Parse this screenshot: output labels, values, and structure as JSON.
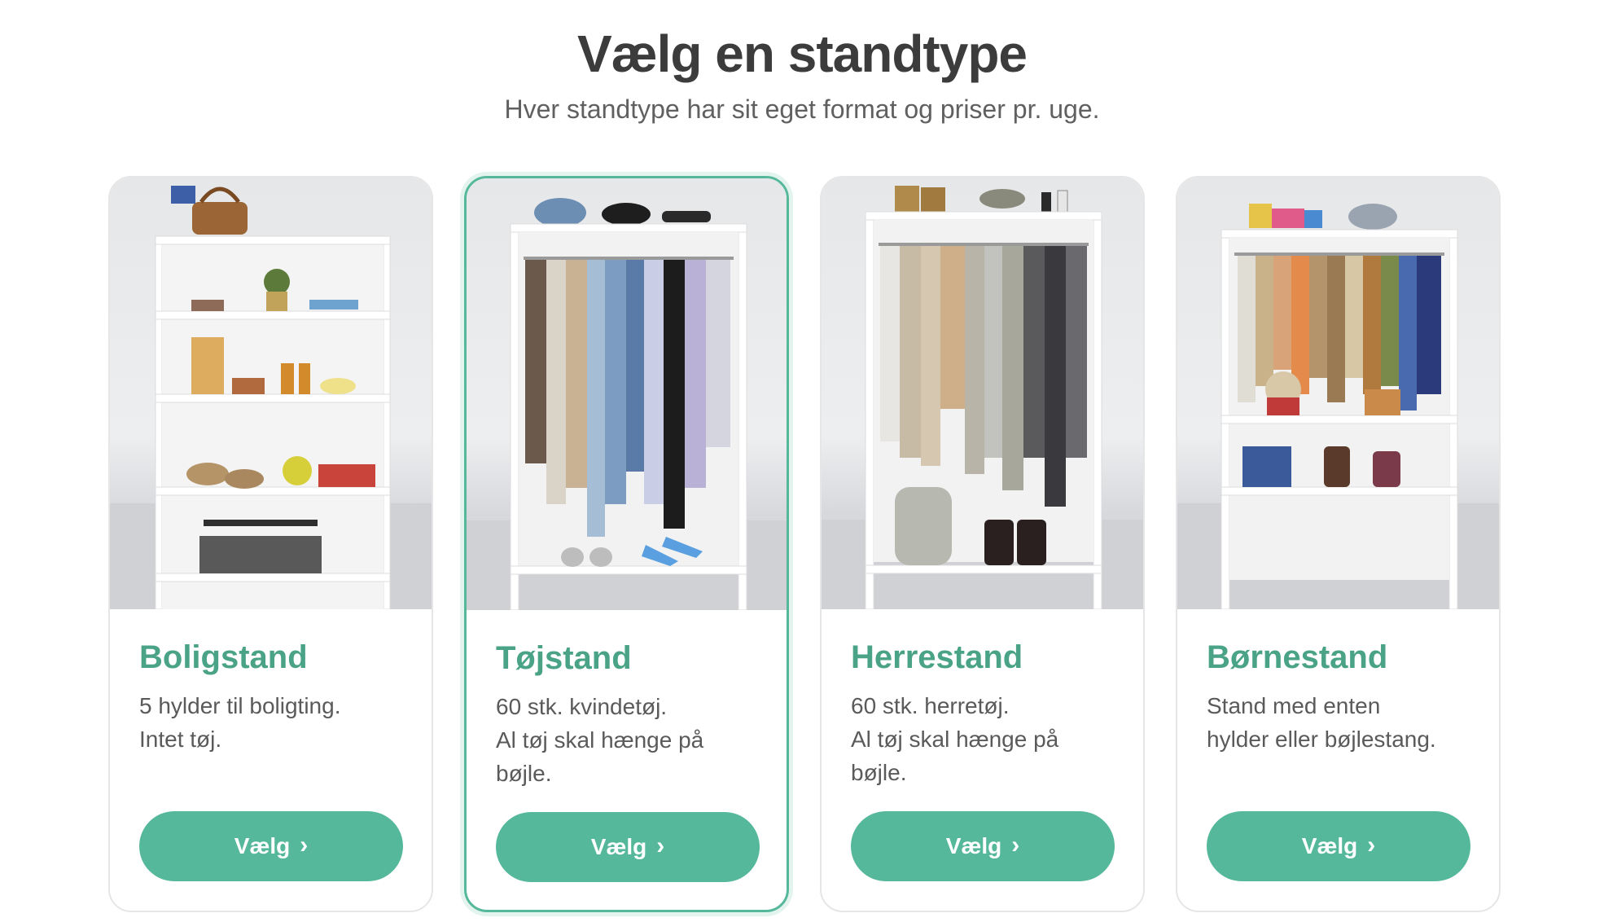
{
  "header": {
    "title": "Vælg en standtype",
    "subtitle": "Hver standtype har sit eget format og priser pr. uge."
  },
  "colors": {
    "accent": "#56b89b",
    "title_green": "#4aa386",
    "text": "#5a5a5a"
  },
  "cards": [
    {
      "title": "Boligstand",
      "desc": [
        "5 hylder til boligting.",
        "Intet tøj."
      ],
      "button_label": "Vælg",
      "button_icon": "chevron-right-icon",
      "image": "shelf-with-home-goods",
      "selected": false
    },
    {
      "title": "Tøjstand",
      "desc": [
        "60 stk. kvindetøj.",
        "Al tøj skal hænge på",
        "bøjle."
      ],
      "button_label": "Vælg",
      "button_icon": "chevron-right-icon",
      "image": "rack-with-womens-clothes",
      "selected": true
    },
    {
      "title": "Herrestand",
      "desc": [
        "60 stk. herretøj.",
        "Al tøj skal hænge på",
        "bøjle."
      ],
      "button_label": "Vælg",
      "button_icon": "chevron-right-icon",
      "image": "rack-with-mens-clothes",
      "selected": false
    },
    {
      "title": "Børnestand",
      "desc": [
        "Stand med enten",
        "hylder eller bøjlestang."
      ],
      "button_label": "Vælg",
      "button_icon": "chevron-right-icon",
      "image": "rack-with-kids-clothes",
      "selected": false
    }
  ]
}
